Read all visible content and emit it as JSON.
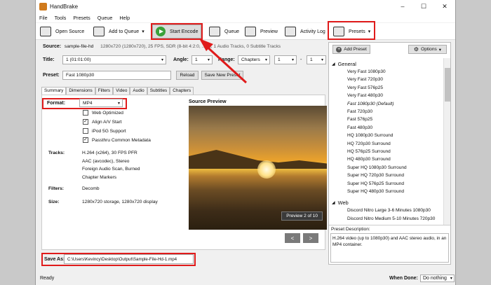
{
  "window": {
    "title": "HandBrake",
    "minimize": "–",
    "maximize": "☐",
    "close": "✕"
  },
  "menu": [
    "File",
    "Tools",
    "Presets",
    "Queue",
    "Help"
  ],
  "toolbar": {
    "open_source": "Open Source",
    "add_to_queue": "Add to Queue",
    "add_to_queue_arrow": "▾",
    "start_encode": "Start Encode",
    "queue": "Queue",
    "preview": "Preview",
    "activity_log": "Activity Log",
    "presets": "Presets"
  },
  "source": {
    "label": "Source:",
    "name": "sample-file-hd",
    "info": "1280x720 (1280x720), 25 FPS, SDR (8-bit 4:2:0, ... 1), 1 Audio Tracks, 0 Subtitle Tracks"
  },
  "title_row": {
    "title_label": "Title:",
    "title_value": "1 (01:01:00)",
    "angle_label": "Angle:",
    "angle_value": "1",
    "range_label": "Range:",
    "range_value": "Chapters",
    "range_start": "1",
    "range_dash": "-",
    "range_end": "1"
  },
  "preset_row": {
    "label": "Preset:",
    "value": "Fast 1080p30",
    "reload": "Reload",
    "save_new": "Save New Preset"
  },
  "tabs": [
    "Summary",
    "Dimensions",
    "Filters",
    "Video",
    "Audio",
    "Subtitles",
    "Chapters"
  ],
  "summary": {
    "format_label": "Format:",
    "format_value": "MP4",
    "checkboxes": [
      {
        "label": "Web Optimized",
        "checked": false
      },
      {
        "label": "Align A/V Start",
        "checked": true
      },
      {
        "label": "iPod 5G Support",
        "checked": false
      },
      {
        "label": "Passthru Common Metadata",
        "checked": true
      }
    ],
    "tracks_label": "Tracks:",
    "tracks": [
      "H.264 (x264), 30 FPS PFR",
      "AAC (avcodec), Stereo",
      "Foreign Audio Scan, Burned",
      "Chapter Markers"
    ],
    "filters_label": "Filters:",
    "filters_value": "Decomb",
    "size_label": "Size:",
    "size_value": "1280x720 storage, 1280x720 display"
  },
  "source_preview": {
    "title": "Source Preview",
    "badge": "Preview 2 of 10",
    "prev": "<",
    "next": ">"
  },
  "presets_panel": {
    "add_preset": "Add Preset",
    "options": "Options",
    "groups": [
      {
        "name": "General",
        "items": [
          "Very Fast 1080p30",
          "Very Fast 720p30",
          "Very Fast 576p25",
          "Very Fast 480p30",
          "Fast 1080p30   (Default)",
          "Fast 720p30",
          "Fast 576p25",
          "Fast 480p30",
          "HQ 1080p30 Surround",
          "HQ 720p30 Surround",
          "HQ 576p25 Surround",
          "HQ 480p30 Surround",
          "Super HQ 1080p30 Surround",
          "Super HQ 720p30 Surround",
          "Super HQ 576p25 Surround",
          "Super HQ 480p30 Surround"
        ]
      },
      {
        "name": "Web",
        "items": [
          "Discord Nitro Large 3-6 Minutes 1080p30",
          "Discord Nitro Medium 5-10 Minutes 720p30"
        ]
      }
    ],
    "description_label": "Preset Description:",
    "description": "H.264 video (up to 1080p30) and AAC stereo audio, in an MP4 container."
  },
  "save_as": {
    "label": "Save As:",
    "path": "C:\\Users\\Kevincy\\Desktop\\Output\\Sample-File-Hd-1.mp4"
  },
  "status": {
    "text": "Ready",
    "when_done_label": "When Done:",
    "when_done_value": "Do nothing"
  },
  "colors": {
    "highlight": "#e01b1b"
  }
}
